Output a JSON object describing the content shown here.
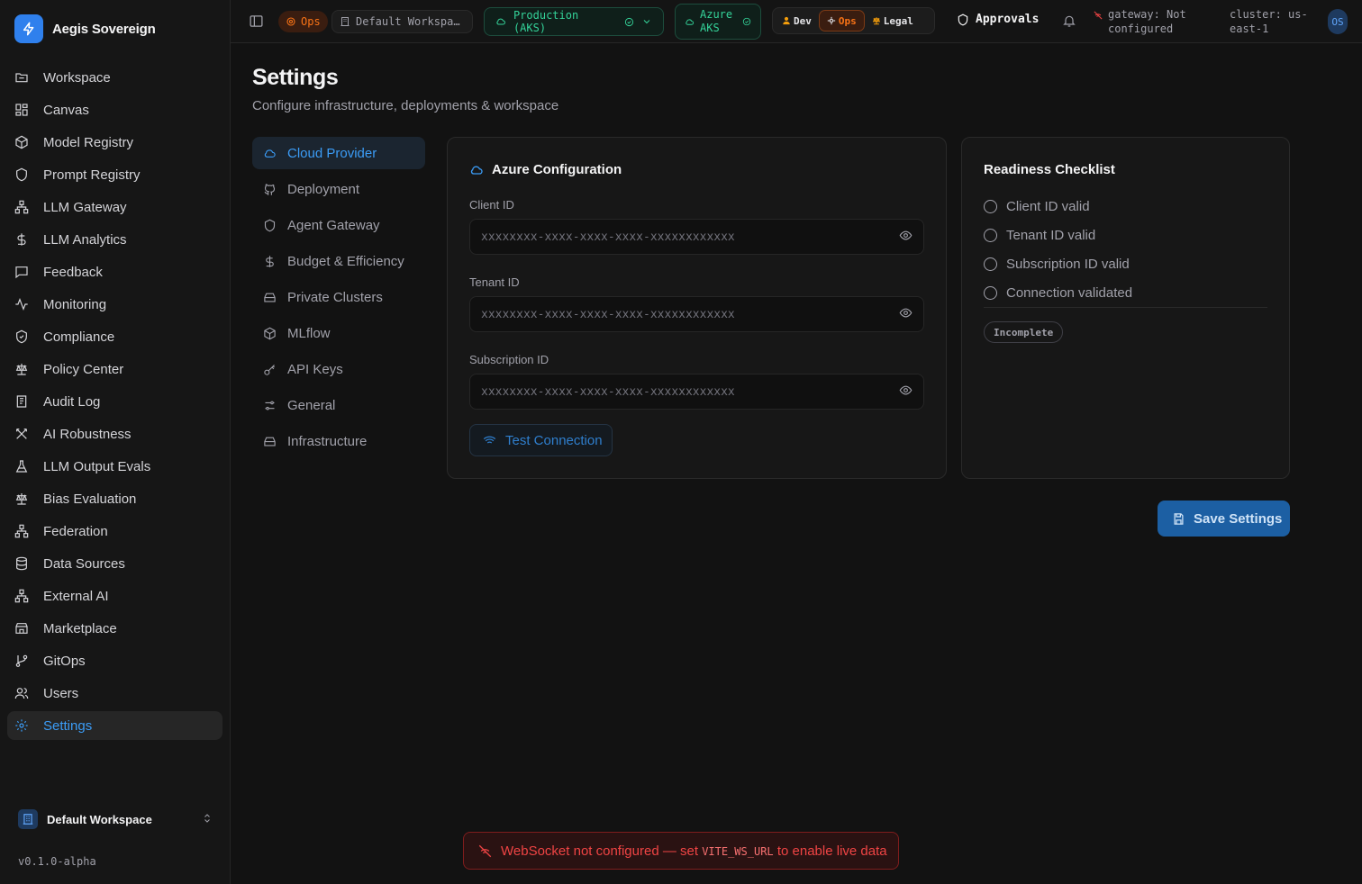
{
  "brand": {
    "name": "Aegis Sovereign"
  },
  "sidebar": {
    "items": [
      {
        "label": "Workspace",
        "icon": "folder-icon"
      },
      {
        "label": "Canvas",
        "icon": "grid-icon"
      },
      {
        "label": "Model Registry",
        "icon": "cube-icon"
      },
      {
        "label": "Prompt Registry",
        "icon": "shield-icon"
      },
      {
        "label": "LLM Gateway",
        "icon": "network-icon"
      },
      {
        "label": "LLM Analytics",
        "icon": "dollar-icon"
      },
      {
        "label": "Feedback",
        "icon": "message-icon"
      },
      {
        "label": "Monitoring",
        "icon": "activity-icon"
      },
      {
        "label": "Compliance",
        "icon": "shield-check-icon"
      },
      {
        "label": "Policy Center",
        "icon": "scale-icon"
      },
      {
        "label": "Audit Log",
        "icon": "log-icon"
      },
      {
        "label": "AI Robustness",
        "icon": "swords-icon"
      },
      {
        "label": "LLM Output Evals",
        "icon": "flask-icon"
      },
      {
        "label": "Bias Evaluation",
        "icon": "scale-icon"
      },
      {
        "label": "Federation",
        "icon": "network-icon"
      },
      {
        "label": "Data Sources",
        "icon": "database-icon"
      },
      {
        "label": "External AI",
        "icon": "network-icon"
      },
      {
        "label": "Marketplace",
        "icon": "store-icon"
      },
      {
        "label": "GitOps",
        "icon": "git-branch-icon"
      },
      {
        "label": "Users",
        "icon": "users-icon"
      },
      {
        "label": "Settings",
        "icon": "gear-icon",
        "active": true
      }
    ],
    "workspace": "Default Workspace",
    "version": "v0.1.0-alpha"
  },
  "topbar": {
    "role_badge": "Ops",
    "workspace": "Default Workspa…",
    "environment": "Production (AKS)",
    "provider_line1": "Azure",
    "provider_line2": "AKS",
    "personas": [
      "Dev",
      "Ops",
      "Legal"
    ],
    "active_persona": "Ops",
    "approvals": "Approvals",
    "gateway_line1": "gateway: Not",
    "gateway_line2": "configured",
    "cluster_line1": "cluster: us-",
    "cluster_line2": "east-1",
    "avatar": "OS"
  },
  "page": {
    "title": "Settings",
    "subtitle": "Configure infrastructure, deployments & workspace"
  },
  "settings_nav": [
    {
      "label": "Cloud Provider",
      "icon": "cloud-icon",
      "active": true
    },
    {
      "label": "Deployment",
      "icon": "git-icon"
    },
    {
      "label": "Agent Gateway",
      "icon": "shield-icon"
    },
    {
      "label": "Budget & Efficiency",
      "icon": "dollar-icon"
    },
    {
      "label": "Private Clusters",
      "icon": "server-icon"
    },
    {
      "label": "MLflow",
      "icon": "cube-icon"
    },
    {
      "label": "API Keys",
      "icon": "key-icon"
    },
    {
      "label": "General",
      "icon": "sliders-icon"
    },
    {
      "label": "Infrastructure",
      "icon": "server-icon"
    }
  ],
  "azure": {
    "title": "Azure Configuration",
    "client_id_label": "Client ID",
    "client_id_placeholder": "xxxxxxxx-xxxx-xxxx-xxxx-xxxxxxxxxxxx",
    "client_id_value": "",
    "tenant_id_label": "Tenant ID",
    "tenant_id_placeholder": "xxxxxxxx-xxxx-xxxx-xxxx-xxxxxxxxxxxx",
    "tenant_id_value": "",
    "subscription_id_label": "Subscription ID",
    "subscription_id_placeholder": "xxxxxxxx-xxxx-xxxx-xxxx-xxxxxxxxxxxx",
    "subscription_id_value": "",
    "test_button": "Test Connection"
  },
  "readiness": {
    "title": "Readiness Checklist",
    "items": [
      "Client ID valid",
      "Tenant ID valid",
      "Subscription ID valid",
      "Connection validated"
    ],
    "status": "Incomplete"
  },
  "save_button": "Save Settings",
  "toast": {
    "prefix": "WebSocket not configured — set",
    "code": "VITE_WS_URL",
    "suffix": "to enable live data"
  },
  "colors": {
    "accent": "#3b9cf6",
    "ops": "#f97316",
    "success": "#34d399",
    "error": "#ef4444"
  }
}
